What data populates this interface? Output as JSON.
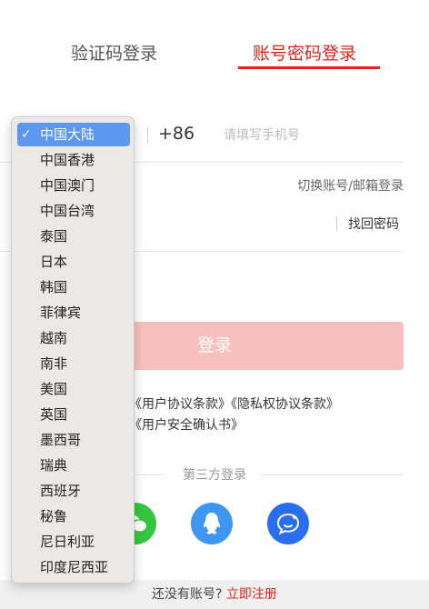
{
  "tabs": {
    "sms_login": "验证码登录",
    "password_login": "账号密码登录"
  },
  "phone": {
    "country_code": "+86",
    "placeholder": "请填写手机号"
  },
  "switch_link": "切换账号/邮箱登录",
  "forgot_password": "找回密码",
  "login_button": "登录",
  "agreement": {
    "line1": "《用户协议条款》《隐私权协议条款》",
    "line2": "《用户安全确认书》"
  },
  "third_party_title": "第三方登录",
  "footer": {
    "prompt": "还没有账号?",
    "register": "立即注册"
  },
  "region_dropdown": {
    "selected_index": 0,
    "check_mark": "✓",
    "options": [
      "中国大陆",
      "中国香港",
      "中国澳门",
      "中国台湾",
      "泰国",
      "日本",
      "韩国",
      "菲律宾",
      "越南",
      "南非",
      "美国",
      "英国",
      "墨西哥",
      "瑞典",
      "西班牙",
      "秘鲁",
      "尼日利亚",
      "印度尼西亚"
    ]
  },
  "icons": {
    "wechat": "wechat-icon",
    "qq": "qq-icon",
    "chat": "chat-bubble-icon"
  },
  "colors": {
    "accent": "#e1251b",
    "login_disabled": "#f7bfbd",
    "wechat": "#35c640",
    "qq": "#3f95f2",
    "chat": "#2a6ef0",
    "dropdown_selected": "#5c97f0"
  }
}
